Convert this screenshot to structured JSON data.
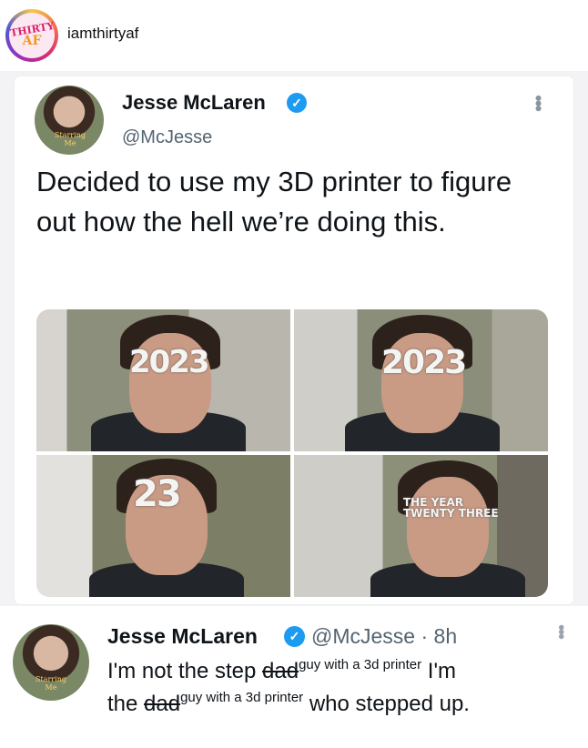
{
  "instagram": {
    "account_username": "iamthirtyaf",
    "avatar_text_line1": "THIRTY",
    "avatar_text_line2": "AF"
  },
  "tweet": {
    "author_name": "Jesse McLaren",
    "author_handle": "@McJesse",
    "avatar_badge": "Starring Me",
    "text": "Decided to use my 3D printer to figure out how the hell we’re doing this.",
    "photos": [
      {
        "glasses_text": "2023"
      },
      {
        "glasses_text": "2023"
      },
      {
        "glasses_text": "23"
      },
      {
        "glasses_text": "THE YEAR TWENTY THREE"
      }
    ]
  },
  "reply": {
    "author_name": "Jesse McLaren",
    "author_handle": "@McJesse",
    "time": "· 8h",
    "avatar_badge": "Starring Me",
    "line1_pre": "I'm not the step ",
    "line1_strike": "dad",
    "line1_sup": "guy with a 3d printer",
    "line1_post": " I'm",
    "line2_pre": "the ",
    "line2_strike": "dad",
    "line2_sup": "guy with a 3d printer",
    "line2_post": " who stepped up."
  },
  "colors": {
    "verified_blue": "#1d9bf0",
    "handle_gray": "#536471",
    "text": "#0f1419"
  }
}
